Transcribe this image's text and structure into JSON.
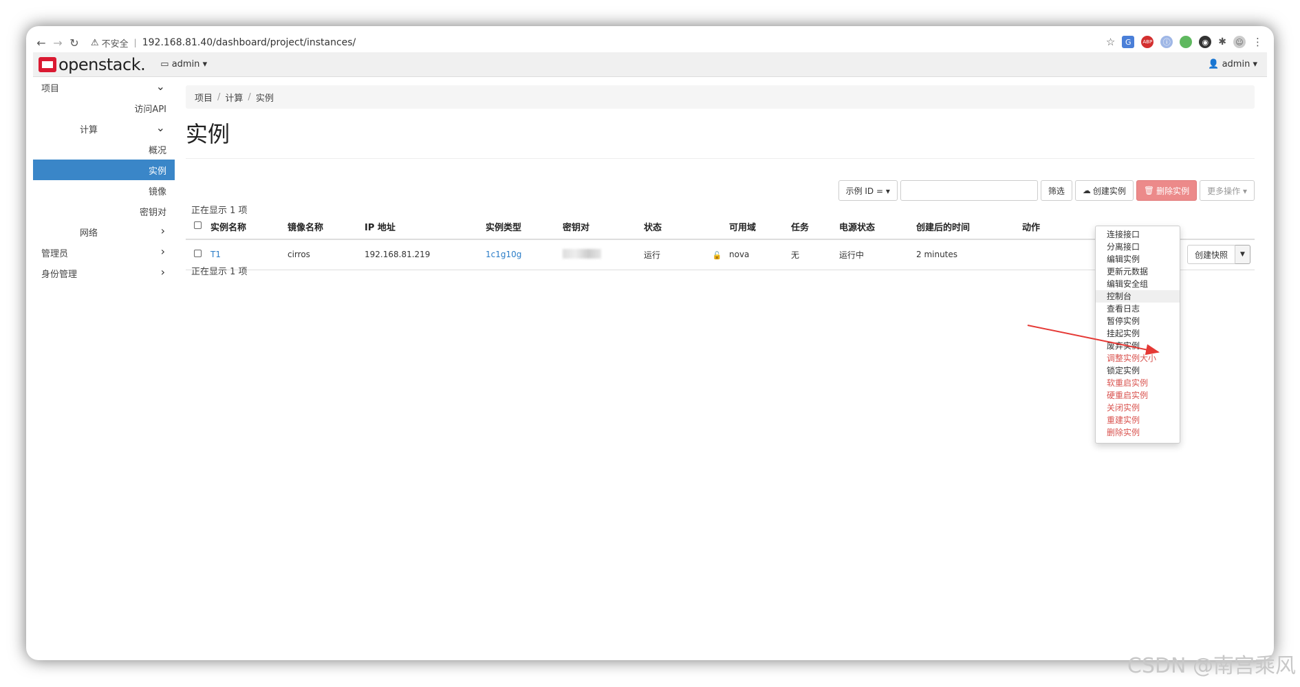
{
  "browser": {
    "security_label": "不安全",
    "url": "192.168.81.40/dashboard/project/instances/"
  },
  "topnav": {
    "logo_text": "openstack.",
    "project_menu": "admin",
    "user_menu": "admin"
  },
  "sidebar": {
    "project": "项目",
    "access_api": "访问API",
    "compute": "计算",
    "overview": "概况",
    "instances": "实例",
    "images": "镜像",
    "keypairs": "密钥对",
    "network": "网络",
    "admin": "管理员",
    "identity": "身份管理"
  },
  "breadcrumb": {
    "items": [
      "项目",
      "计算",
      "实例"
    ]
  },
  "page": {
    "title": "实例"
  },
  "toolbar": {
    "filter_select": "示例 ID = ▾",
    "filter_value": "",
    "filter_button": "筛选",
    "launch_button": "创建实例",
    "delete_button": "删除实例",
    "more_button": "更多操作 ▾"
  },
  "table": {
    "count_top": "正在显示 1 项",
    "count_bottom": "正在显示 1 项",
    "headers": [
      "实例名称",
      "镜像名称",
      "IP 地址",
      "实例类型",
      "密钥对",
      "状态",
      "可用域",
      "任务",
      "电源状态",
      "创建后的时间",
      "动作"
    ],
    "rows": [
      {
        "name": "T1",
        "image": "cirros",
        "ip": "192.168.81.219",
        "flavor": "1c1g10g",
        "status": "运行",
        "zone": "nova",
        "task": "无",
        "power": "运行中",
        "age": "2 minutes",
        "action": "创建快照"
      }
    ]
  },
  "dropdown": {
    "items": [
      {
        "label": "连接接口",
        "danger": false
      },
      {
        "label": "分离接口",
        "danger": false
      },
      {
        "label": "编辑实例",
        "danger": false
      },
      {
        "label": "更新元数据",
        "danger": false
      },
      {
        "label": "编辑安全组",
        "danger": false
      },
      {
        "label": "控制台",
        "danger": false
      },
      {
        "label": "查看日志",
        "danger": false
      },
      {
        "label": "暂停实例",
        "danger": false
      },
      {
        "label": "挂起实例",
        "danger": false
      },
      {
        "label": "废弃实例",
        "danger": false
      },
      {
        "label": "调整实例大小",
        "danger": true
      },
      {
        "label": "锁定实例",
        "danger": false
      },
      {
        "label": "软重启实例",
        "danger": true
      },
      {
        "label": "硬重启实例",
        "danger": true
      },
      {
        "label": "关闭实例",
        "danger": true
      },
      {
        "label": "重建实例",
        "danger": true
      },
      {
        "label": "删除实例",
        "danger": true
      }
    ]
  },
  "watermark": "CSDN @南宫乘风",
  "colors": {
    "brand_red": "#da1a32",
    "active_blue": "#3a86c8",
    "link_blue": "#2a7cc7",
    "danger_red": "#d9534f",
    "annotation_arrow": "#e53935"
  }
}
